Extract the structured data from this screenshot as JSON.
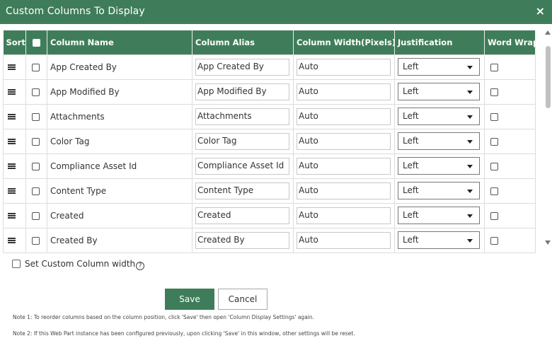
{
  "dialog": {
    "title": "Custom Columns To Display",
    "close_label": "×"
  },
  "table": {
    "headers": {
      "sort": "Sort",
      "column_name": "Column Name",
      "column_alias": "Column Alias",
      "column_width": "Column Width(Pixels)",
      "justification": "Justification",
      "word_wrap": "Word Wrap"
    },
    "rows": [
      {
        "name": "App Created By",
        "alias": "App Created By",
        "width": "Auto",
        "justification": "Left"
      },
      {
        "name": "App Modified By",
        "alias": "App Modified By",
        "width": "Auto",
        "justification": "Left"
      },
      {
        "name": "Attachments",
        "alias": "Attachments",
        "width": "Auto",
        "justification": "Left"
      },
      {
        "name": "Color Tag",
        "alias": "Color Tag",
        "width": "Auto",
        "justification": "Left"
      },
      {
        "name": "Compliance Asset Id",
        "alias": "Compliance Asset Id",
        "width": "Auto",
        "justification": "Left"
      },
      {
        "name": "Content Type",
        "alias": "Content Type",
        "width": "Auto",
        "justification": "Left"
      },
      {
        "name": "Created",
        "alias": "Created",
        "width": "Auto",
        "justification": "Left"
      },
      {
        "name": "Created By",
        "alias": "Created By",
        "width": "Auto",
        "justification": "Left"
      }
    ]
  },
  "custom_width": {
    "label": "Set Custom Column width",
    "help_glyph": "?"
  },
  "buttons": {
    "save": "Save",
    "cancel": "Cancel"
  },
  "notes": {
    "note1": "Note 1: To reorder columns based on the column position, click 'Save' then open 'Column Display Settings' again.",
    "note2": "Note 2: If this Web Part instance has been configured previously, upon clicking 'Save' in this window, other settings will be reset."
  },
  "colors": {
    "accent": "#3f7d5a"
  }
}
